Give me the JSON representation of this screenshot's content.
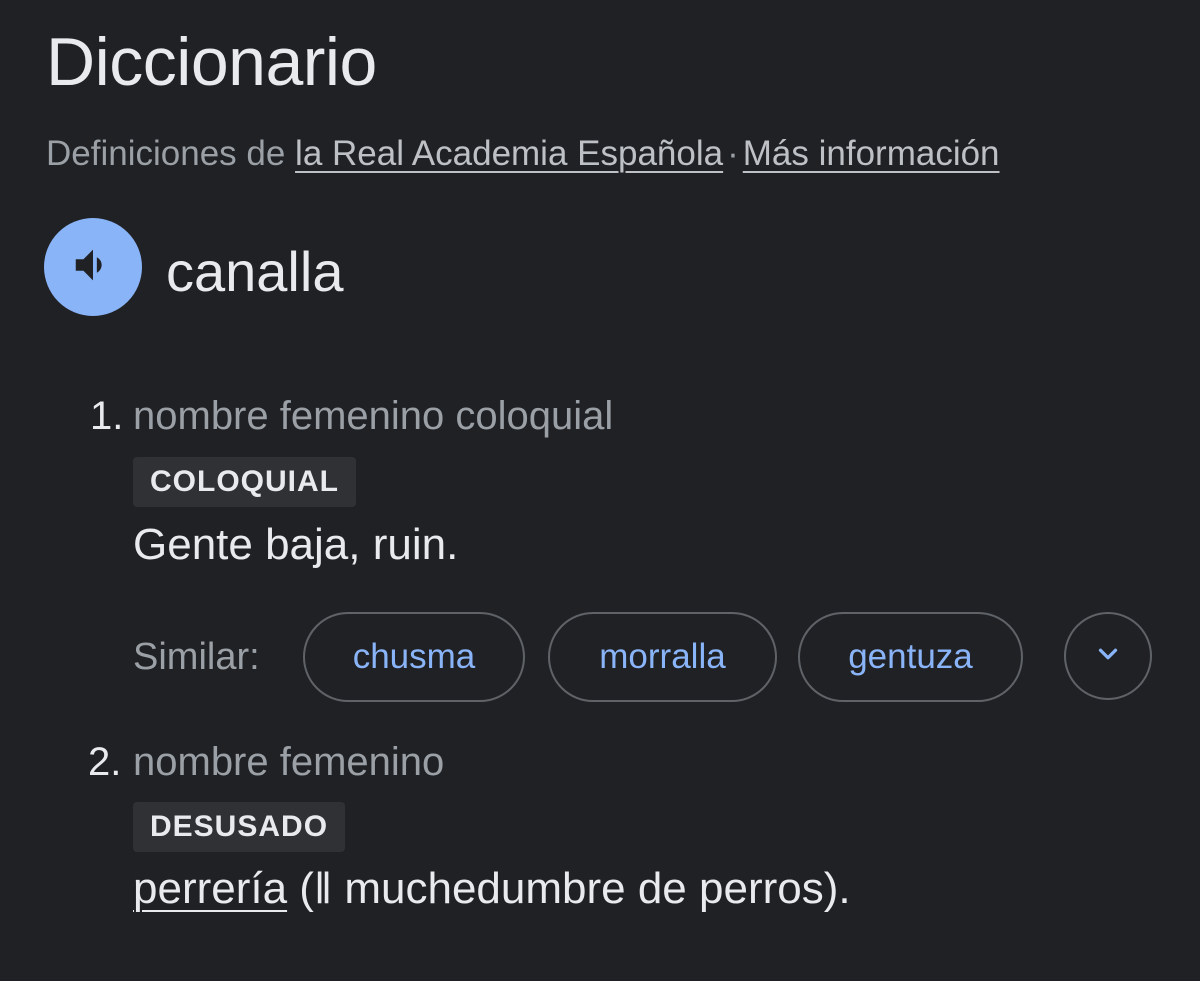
{
  "header": {
    "title": "Diccionario",
    "source_prefix": "Definiciones de",
    "source_link": "la Real Academia Española",
    "separator": "·",
    "more_info": "Más información"
  },
  "entry": {
    "word": "canalla",
    "speak_icon": "volume-up-icon"
  },
  "senses": [
    {
      "number": "1.",
      "part_of_speech": "nombre femenino coloquial",
      "tag": "COLOQUIAL",
      "definition": "Gente baja, ruin.",
      "similar_label": "Similar:",
      "similar": [
        "chusma",
        "morralla",
        "gentuza"
      ],
      "expand_icon": "chevron-down-icon"
    },
    {
      "number": "2.",
      "part_of_speech": "nombre femenino",
      "tag": "DESUSADO",
      "definition_link": "perrería",
      "definition_rest": " (‖ muchedumbre de perros)."
    }
  ],
  "colors": {
    "background": "#202124",
    "accent": "#8ab4f8",
    "text": "#e8eaed",
    "muted": "#9aa0a6",
    "tag_bg": "#303134"
  }
}
